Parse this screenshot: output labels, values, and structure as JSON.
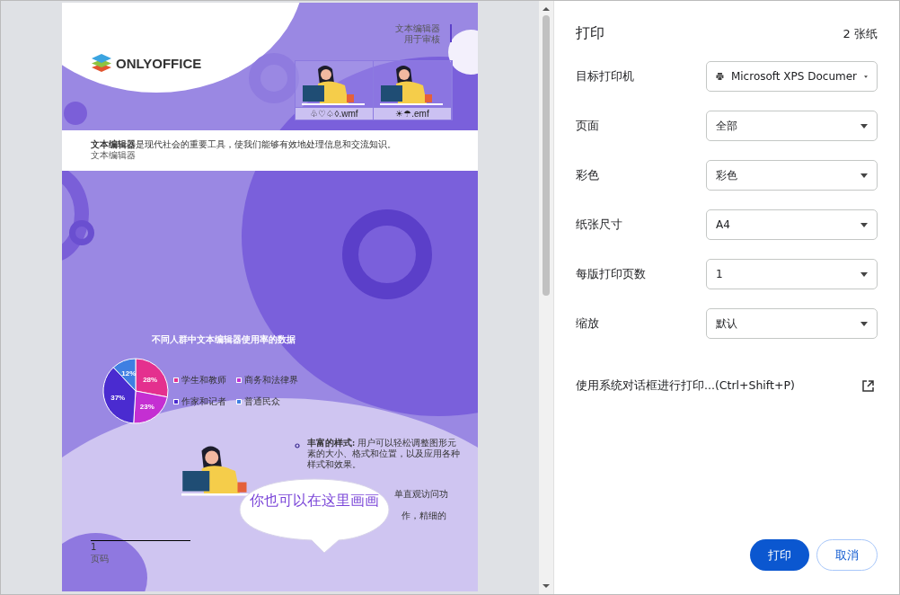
{
  "preview": {
    "logo": "ONLYOFFICE",
    "header_lines": [
      "文本编辑器",
      "用于审核"
    ],
    "image_captions": [
      "♧♡♤◊.wmf",
      "☀☂.emf"
    ],
    "intro": "**文本编辑器**是现代社会的重要工具，使我们能够有效地处理信息和交流知识。",
    "intro_sub": "文本编辑器",
    "chart": {
      "chart_data": {
        "type": "pie",
        "title": "不同人群中文本编辑器使用率的数据",
        "categories": [
          "学生和教师",
          "商务和法律界",
          "作家和记者",
          "普通民众"
        ],
        "values": [
          28,
          23,
          37,
          12
        ],
        "value_labels": [
          "28%",
          "23%",
          "37%",
          "12%"
        ],
        "legend": "right"
      },
      "slices": [
        {
          "color": "#e4308e"
        },
        {
          "color": "#c42fd2"
        },
        {
          "color": "#4a2bd0"
        },
        {
          "color": "#3f7fe2"
        }
      ]
    },
    "bullet": "**丰富的样式:** 用户可以轻松调整图形元素的大小、格式和位置，以及应用各种样式和效果。",
    "hidden_fragments": [
      "单直观访问功",
      "作，精细的"
    ],
    "bubble": "你也可以在这里画画",
    "footnote": "1",
    "footer": "页码"
  },
  "panel": {
    "title": "打印",
    "sheets": "2 张纸",
    "rows": [
      {
        "label": "目标打印机",
        "value": "Microsoft XPS Documer",
        "kind": "printer"
      },
      {
        "label": "页面",
        "value": "全部",
        "kind": "select"
      },
      {
        "label": "彩色",
        "value": "彩色",
        "kind": "select"
      },
      {
        "label": "纸张尺寸",
        "value": "A4",
        "kind": "select"
      },
      {
        "label": "每版打印页数",
        "value": "1",
        "kind": "select"
      },
      {
        "label": "缩放",
        "value": "默认",
        "kind": "select"
      }
    ],
    "system_dialog": "使用系统对话框进行打印...(Ctrl+Shift+P)",
    "buttons": [
      {
        "label": "打印",
        "kind": "primary"
      },
      {
        "label": "取消",
        "kind": "secondary"
      }
    ]
  }
}
